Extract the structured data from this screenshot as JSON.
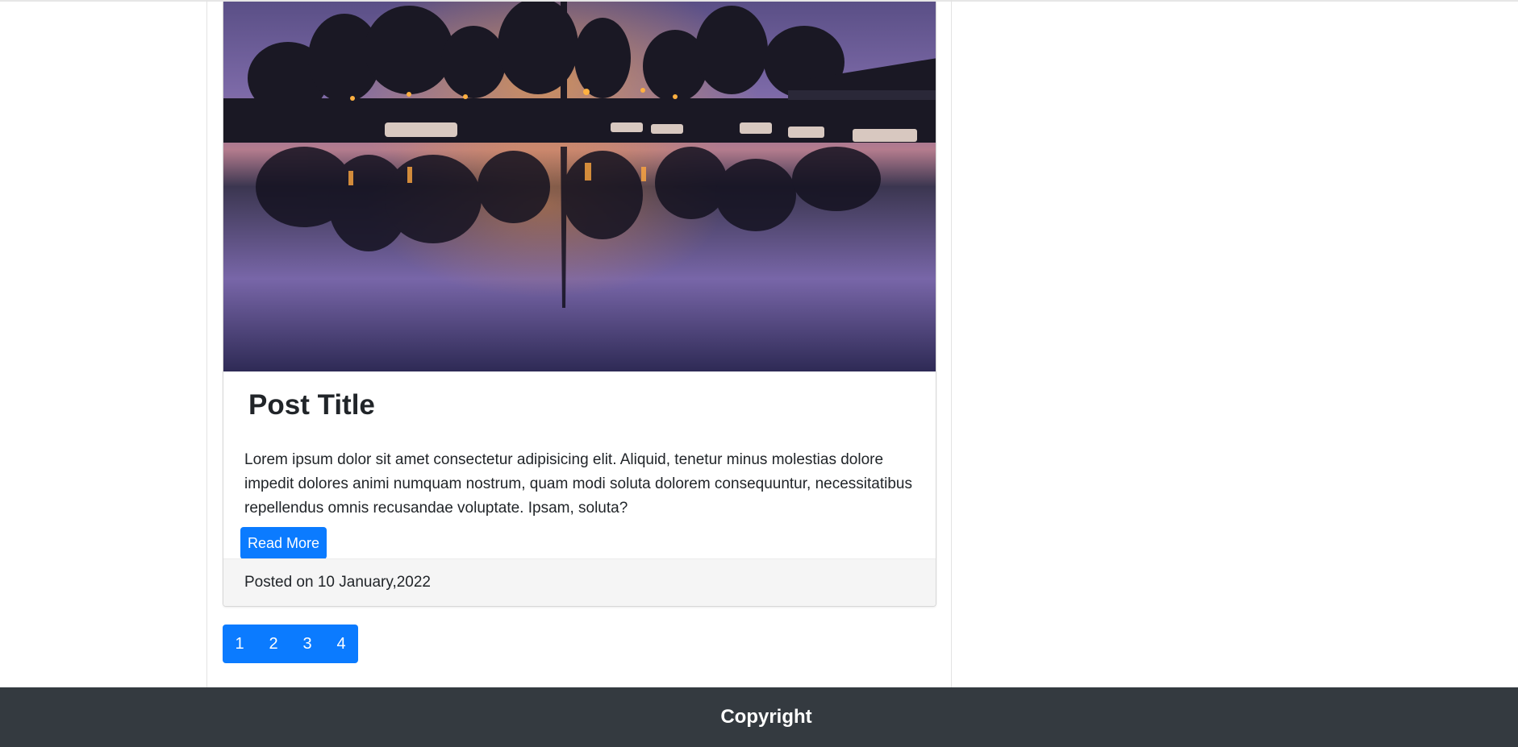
{
  "post": {
    "title": "Post Title",
    "excerpt": "Lorem ipsum dolor sit amet consectetur adipisicing elit. Aliquid, tenetur minus molestias dolore impedit dolores animi numquam nostrum, quam modi soluta dolorem consequuntur, necessitatibus repellendus omnis recusandae voluptate. Ipsam, soluta?",
    "read_more_label": "Read More",
    "posted_on": "Posted on 10 January,2022"
  },
  "pagination": {
    "pages": [
      "1",
      "2",
      "3",
      "4"
    ]
  },
  "footer": {
    "text": "Copyright"
  },
  "colors": {
    "primary": "#0b7bff",
    "footer_bg": "#343a40",
    "card_footer_bg": "#f5f5f5"
  }
}
